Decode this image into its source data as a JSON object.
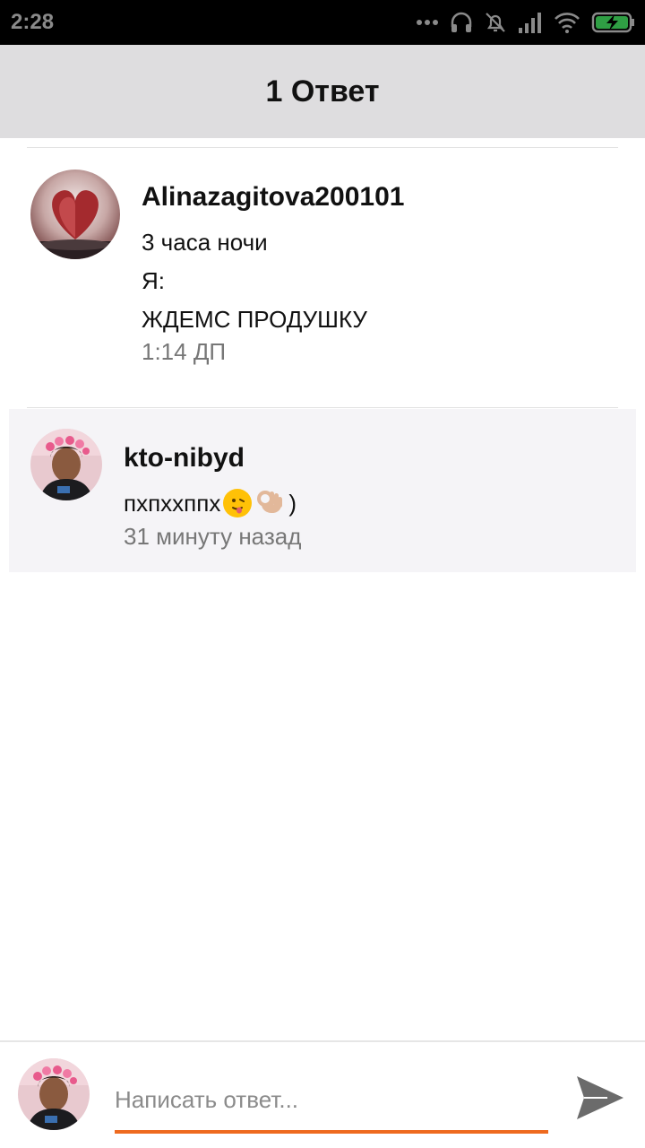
{
  "status_bar": {
    "time": "2:28"
  },
  "header": {
    "title": "1 Ответ"
  },
  "comment": {
    "author": "Alinazagitova200101",
    "lines": [
      "3 часа ночи",
      "Я:",
      "ЖДЕМС ПРОДУШКУ"
    ],
    "time": "1:14 ДП"
  },
  "reply": {
    "author": "kto-nibyd",
    "text": "пхпххппх",
    "text_suffix": ")",
    "emojis": [
      "face-with-tongue-emoji",
      "ok-hand-emoji"
    ],
    "time": "31 минуту назад"
  },
  "composer": {
    "placeholder": "Написать ответ...",
    "send_icon": "send-icon",
    "accent_color": "#ee6a1f"
  }
}
